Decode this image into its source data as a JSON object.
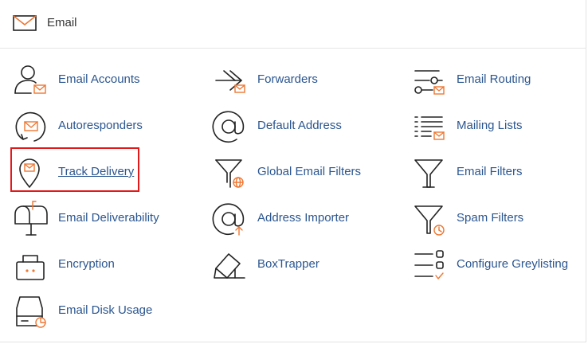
{
  "header": {
    "title": "Email",
    "icon": "envelope-icon"
  },
  "accent_color": "#ee7733",
  "link_color": "#2b5690",
  "highlight_color": "#e1191b",
  "items": [
    {
      "label": "Email Accounts",
      "icon": "email-accounts-icon"
    },
    {
      "label": "Forwarders",
      "icon": "forwarders-icon"
    },
    {
      "label": "Email Routing",
      "icon": "email-routing-icon"
    },
    {
      "label": "Autoresponders",
      "icon": "autoresponders-icon"
    },
    {
      "label": "Default Address",
      "icon": "default-address-icon"
    },
    {
      "label": "Mailing Lists",
      "icon": "mailing-lists-icon"
    },
    {
      "label": "Track Delivery",
      "icon": "track-delivery-icon"
    },
    {
      "label": "Global Email Filters",
      "icon": "global-email-filters-icon"
    },
    {
      "label": "Email Filters",
      "icon": "email-filters-icon"
    },
    {
      "label": "Email Deliverability",
      "icon": "email-deliverability-icon"
    },
    {
      "label": "Address Importer",
      "icon": "address-importer-icon"
    },
    {
      "label": "Spam Filters",
      "icon": "spam-filters-icon"
    },
    {
      "label": "Encryption",
      "icon": "encryption-icon"
    },
    {
      "label": "BoxTrapper",
      "icon": "boxtrapper-icon"
    },
    {
      "label": "Configure Greylisting",
      "icon": "configure-greylisting-icon"
    },
    {
      "label": "Email Disk Usage",
      "icon": "email-disk-usage-icon"
    }
  ]
}
